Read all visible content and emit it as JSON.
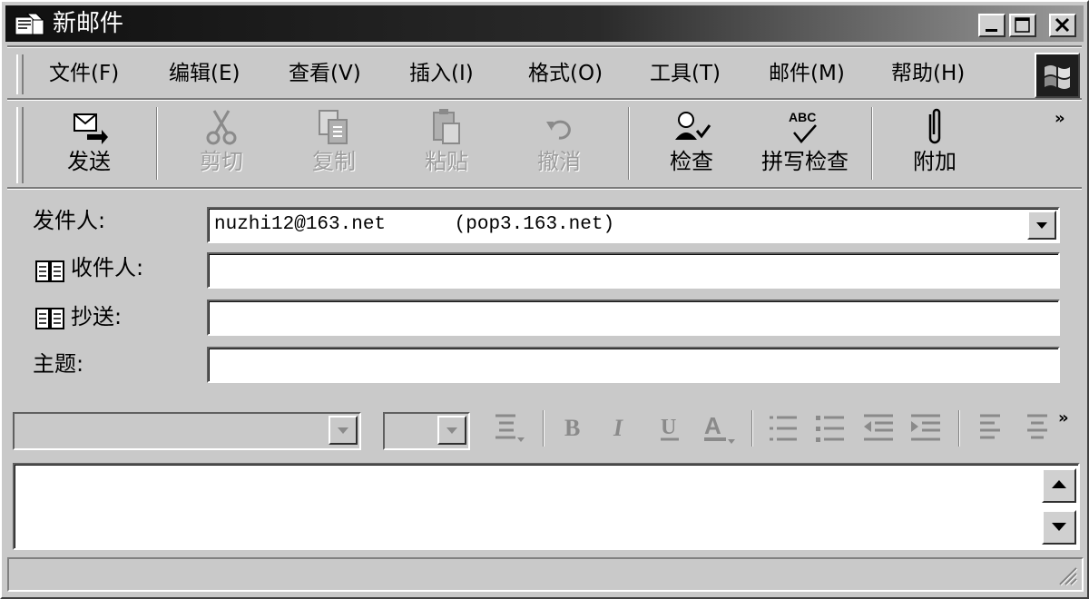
{
  "window": {
    "title": "新邮件"
  },
  "menu": [
    {
      "label": "文件(F)"
    },
    {
      "label": "编辑(E)"
    },
    {
      "label": "查看(V)"
    },
    {
      "label": "插入(I)"
    },
    {
      "label": "格式(O)"
    },
    {
      "label": "工具(T)"
    },
    {
      "label": "邮件(M)"
    },
    {
      "label": "帮助(H)"
    }
  ],
  "toolbar": {
    "send": "发送",
    "cut": "剪切",
    "copy": "复制",
    "paste": "粘贴",
    "undo": "撤消",
    "check": "检查",
    "spelling": "拼写检查",
    "attach": "附加",
    "more": "»"
  },
  "fields": {
    "from_label": "发件人:",
    "from_value": "nuzhi12@163.net      (pop3.163.net)",
    "to_label": "收件人:",
    "to_value": "",
    "cc_label": "抄送:",
    "cc_value": "",
    "subject_label": "主题:",
    "subject_value": ""
  },
  "format_bar": {
    "font": "",
    "size": "",
    "more": "»"
  },
  "body": {
    "text": ""
  },
  "colors": {
    "titlebar": "#101010",
    "face": "#c9c9c9",
    "disabled_text": "#9c9c9c"
  }
}
